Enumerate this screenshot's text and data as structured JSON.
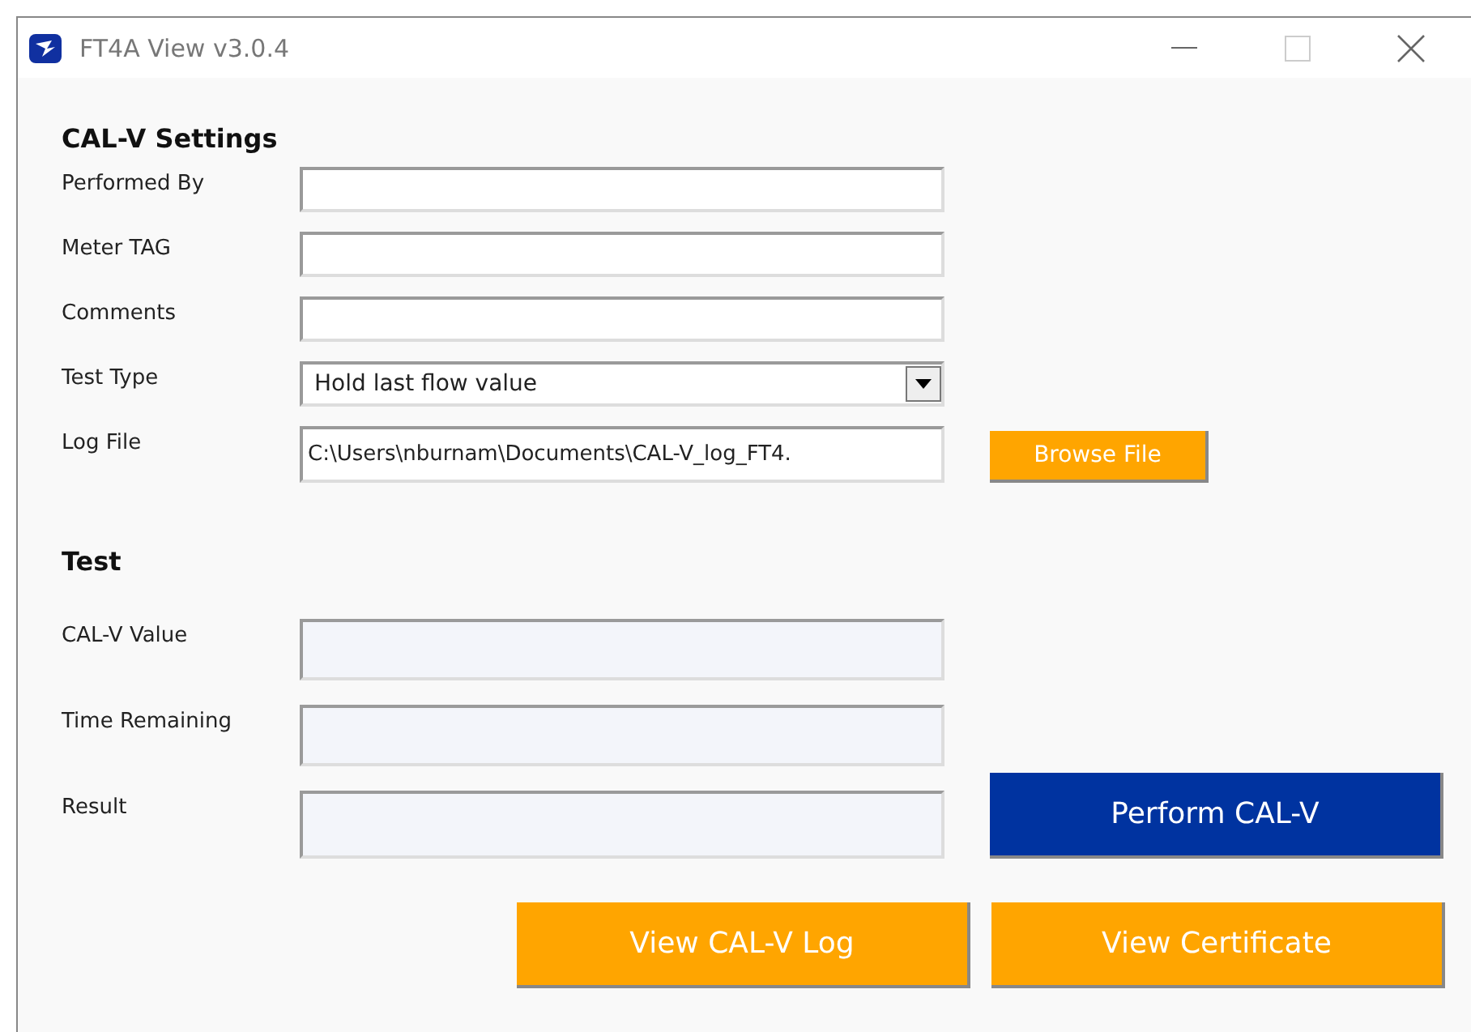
{
  "window": {
    "title": "FT4A View v3.0.4"
  },
  "settings": {
    "heading": "CAL-V Settings",
    "rows": [
      {
        "label": "Performed By",
        "kind": "text",
        "value": ""
      },
      {
        "label": "Meter TAG",
        "kind": "text",
        "value": ""
      },
      {
        "label": "Comments",
        "kind": "text",
        "value": ""
      },
      {
        "label": "Test Type",
        "kind": "dropdown",
        "value": "Hold last flow value"
      },
      {
        "label": "Log File",
        "kind": "text",
        "value": "C:\\Users\\nburnam\\Documents\\CAL-V_log_FT4.",
        "button": "Browse File"
      }
    ]
  },
  "test": {
    "heading": "Test",
    "rows": [
      {
        "label": "CAL-V Value",
        "disabled": true
      },
      {
        "label": "Time Remaining",
        "disabled": true
      },
      {
        "label": "Result",
        "disabled": true,
        "button": "Perform CAL-V"
      }
    ]
  },
  "buttons": [
    {
      "label": "View CAL-V Log",
      "kind": "accent"
    },
    {
      "label": "View Certificate",
      "kind": "accent"
    }
  ]
}
